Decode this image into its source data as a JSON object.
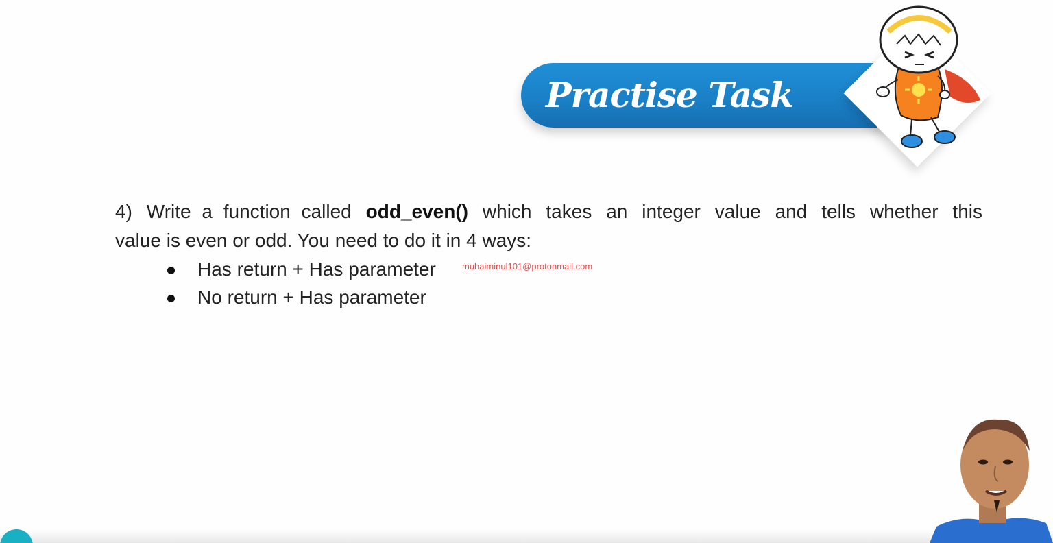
{
  "banner": {
    "title": "Practise Task"
  },
  "task": {
    "number": "4)",
    "line1_pre": "Write a function called",
    "function_name": "odd_even()",
    "line1_words": [
      "which",
      "takes",
      "an",
      "integer",
      "value",
      "and",
      "tells",
      "whether",
      "this"
    ],
    "line2": "value is even or odd. You need to do it in 4 ways:",
    "bullets": [
      "Has return + Has parameter",
      "No return + Has parameter"
    ]
  },
  "watermark": "muhaiminul101@protonmail.com",
  "colors": {
    "banner_blue": "#1a7fc6",
    "watermark_red": "#e05050",
    "teal": "#1ab0c4"
  }
}
